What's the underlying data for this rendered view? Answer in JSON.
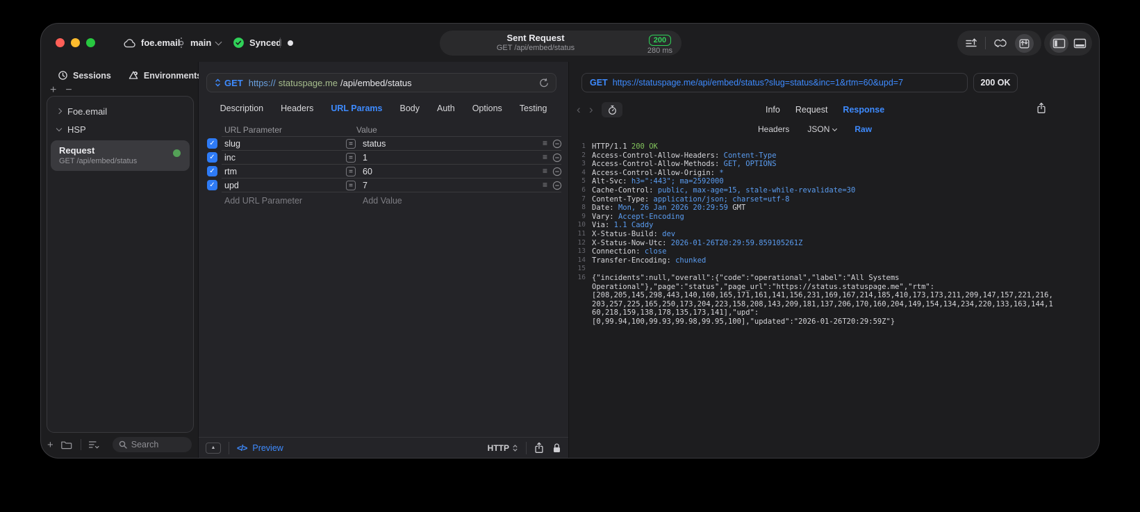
{
  "colors": {
    "accent_blue": "#3e8bff",
    "status_green": "#30d158",
    "checkbox_blue": "#2e7bf6",
    "mono_value_blue": "#5a9cf0",
    "mono_status_green": "#82c35c",
    "url_host_green": "#a6bd8d"
  },
  "titlebar": {
    "project": "foe.email",
    "branch": "main",
    "sync_label": "Synced",
    "request_pill": {
      "title": "Sent Request",
      "subtitle": "GET /api/embed/status",
      "status_code": "200",
      "duration": "280 ms"
    },
    "icons": [
      "scroll-to-top",
      "sync-flows",
      "import-export",
      "toggle-left-panel",
      "toggle-bottom-panel"
    ]
  },
  "sidebar": {
    "tabs": [
      {
        "label": "Sessions",
        "icon": "history-clock"
      },
      {
        "label": "Environments",
        "icon": "environments-cycle"
      }
    ],
    "tree": {
      "collapsed_item": "Foe.email",
      "expanded_item": "HSP",
      "request": {
        "title": "Request",
        "subtitle": "GET /api/embed/status"
      }
    },
    "search_placeholder": "Search"
  },
  "editor": {
    "method": "GET",
    "url": {
      "scheme": "https://",
      "host": "statuspage.me",
      "path": "/api/embed/status"
    },
    "tabs": [
      "Description",
      "Headers",
      "URL Params",
      "Body",
      "Auth",
      "Options",
      "Testing"
    ],
    "active_tab": "URL Params",
    "params": {
      "columns": [
        "URL Parameter",
        "Value"
      ],
      "rows": [
        {
          "name": "slug",
          "value": "status",
          "enabled": true
        },
        {
          "name": "inc",
          "value": "1",
          "enabled": true
        },
        {
          "name": "rtm",
          "value": "60",
          "enabled": true
        },
        {
          "name": "upd",
          "value": "7",
          "enabled": true
        }
      ],
      "add_name_placeholder": "Add URL Parameter",
      "add_value_placeholder": "Add Value"
    },
    "footer": {
      "code_glyph": "</>",
      "preview_label": "Preview",
      "protocol": "HTTP"
    }
  },
  "response": {
    "request_line": {
      "method": "GET",
      "url": "https://statuspage.me/api/embed/status?slug=status&inc=1&rtm=60&upd=7"
    },
    "status": "200 OK",
    "tabs": [
      "Info",
      "Request",
      "Response"
    ],
    "active_tab": "Response",
    "subtabs": [
      "Headers",
      "JSON",
      "Raw"
    ],
    "active_subtab": "Raw",
    "raw": {
      "lines": [
        {
          "n": "1",
          "segs": [
            [
              "HTTP/1.1 ",
              "p"
            ],
            [
              "200 OK",
              "g"
            ]
          ]
        },
        {
          "n": "2",
          "segs": [
            [
              "Access-Control-Allow-Headers: ",
              "p"
            ],
            [
              "Content-Type",
              "b"
            ]
          ]
        },
        {
          "n": "3",
          "segs": [
            [
              "Access-Control-Allow-Methods: ",
              "p"
            ],
            [
              "GET, OPTIONS",
              "b"
            ]
          ]
        },
        {
          "n": "4",
          "segs": [
            [
              "Access-Control-Allow-Origin: ",
              "p"
            ],
            [
              "*",
              "b"
            ]
          ]
        },
        {
          "n": "5",
          "segs": [
            [
              "Alt-Svc: ",
              "p"
            ],
            [
              "h3=\":443\"; ma=2592000",
              "b"
            ]
          ]
        },
        {
          "n": "6",
          "segs": [
            [
              "Cache-Control: ",
              "p"
            ],
            [
              "public, max-age=15, stale-while-revalidate=30",
              "b"
            ]
          ]
        },
        {
          "n": "7",
          "segs": [
            [
              "Content-Type: ",
              "p"
            ],
            [
              "application/json; charset=utf-8",
              "b"
            ]
          ]
        },
        {
          "n": "8",
          "segs": [
            [
              "Date: ",
              "p"
            ],
            [
              "Mon, 26 Jan 2026 20:29:59 ",
              "b"
            ],
            [
              "GMT",
              "p"
            ]
          ]
        },
        {
          "n": "9",
          "segs": [
            [
              "Vary: ",
              "p"
            ],
            [
              "Accept-Encoding",
              "b"
            ]
          ]
        },
        {
          "n": "10",
          "segs": [
            [
              "Via: ",
              "p"
            ],
            [
              "1.1 Caddy",
              "b"
            ]
          ]
        },
        {
          "n": "11",
          "segs": [
            [
              "X-Status-Build: ",
              "p"
            ],
            [
              "dev",
              "b"
            ]
          ]
        },
        {
          "n": "12",
          "segs": [
            [
              "X-Status-Now-Utc: ",
              "p"
            ],
            [
              "2026-01-26T20:29:59.859105261Z",
              "b"
            ]
          ]
        },
        {
          "n": "13",
          "segs": [
            [
              "Connection: ",
              "p"
            ],
            [
              "close",
              "b"
            ]
          ]
        },
        {
          "n": "14",
          "segs": [
            [
              "Transfer-Encoding: ",
              "p"
            ],
            [
              "chunked",
              "b"
            ]
          ]
        },
        {
          "n": "15",
          "segs": []
        },
        {
          "n": "16",
          "segs": [
            [
              "{\"incidents\":null,\"overall\":{\"code\":\"operational\",\"label\":\"All Systems",
              "p"
            ]
          ]
        },
        {
          "n": "",
          "segs": [
            [
              "Operational\"},\"page\":\"status\",\"page_url\":\"https://status.statuspage.me\",\"rtm\":",
              "p"
            ]
          ]
        },
        {
          "n": "",
          "segs": [
            [
              "[208,205,145,298,443,140,160,165,171,161,141,156,231,169,167,214,185,410,173,173,211,209,147,157,221,216,",
              "p"
            ]
          ]
        },
        {
          "n": "",
          "segs": [
            [
              "203,257,225,165,250,173,204,223,158,208,143,209,181,137,206,170,160,204,149,154,134,234,220,133,163,144,1",
              "p"
            ]
          ]
        },
        {
          "n": "",
          "segs": [
            [
              "60,218,159,138,178,135,173,141],\"upd\":",
              "p"
            ]
          ]
        },
        {
          "n": "",
          "segs": [
            [
              "[0,99.94,100,99.93,99.98,99.95,100],\"updated\":\"2026-01-26T20:29:59Z\"}",
              "p"
            ]
          ]
        }
      ]
    }
  }
}
